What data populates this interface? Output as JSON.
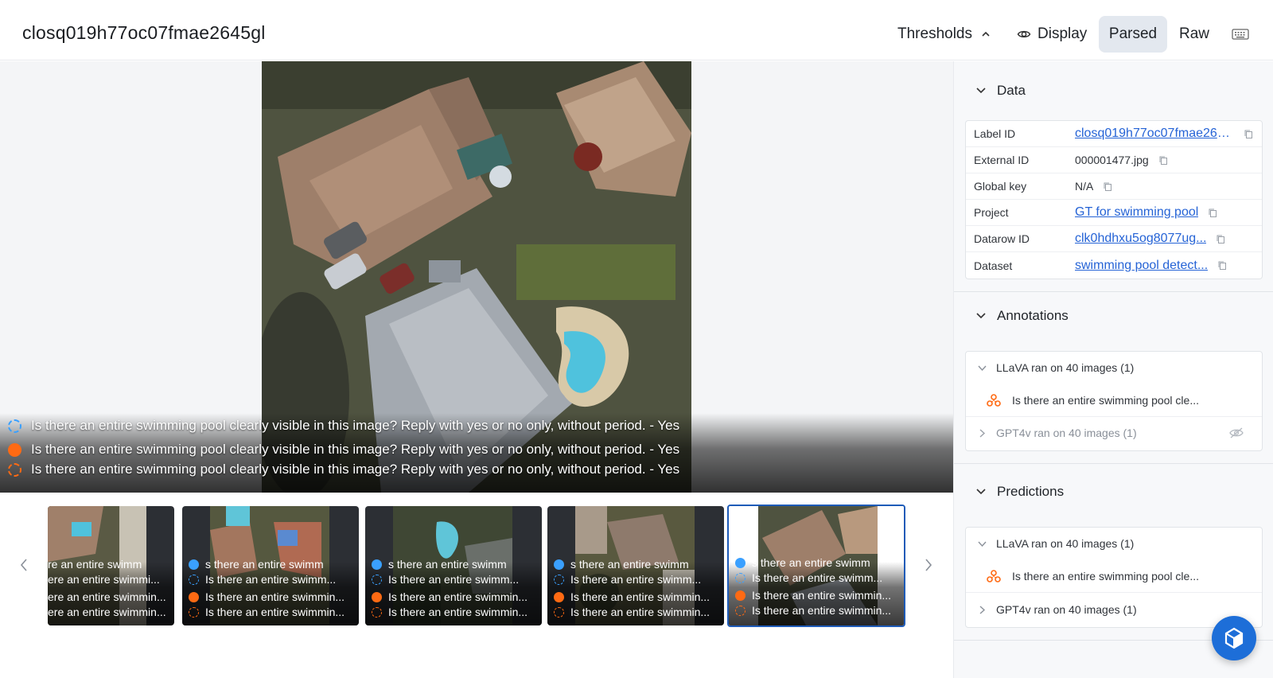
{
  "header": {
    "title": "closq019h77oc07fmae2645gl",
    "thresholds_label": "Thresholds",
    "display_label": "Display",
    "parsed_label": "Parsed",
    "raw_label": "Raw"
  },
  "viewer": {
    "overlay_lines": [
      "Is there an entire swimming pool clearly visible in this image? Reply with yes or no only, without period. - Yes",
      "Is there an entire swimming pool clearly visible in this image? Reply with yes or no only, without period. - Yes",
      "Is there an entire swimming pool clearly visible in this image? Reply with yes or no only, without period. - Yes"
    ]
  },
  "thumbnails": [
    {
      "lines": [
        "re an entire swimm",
        "ere an entire swimmi...",
        "ere an entire swimmin...",
        "ere an entire swimmin..."
      ]
    },
    {
      "lines": [
        "s there an entire swimm",
        "Is there an entire swimm...",
        "Is there an entire swimmin...",
        "Is there an entire swimmin..."
      ]
    },
    {
      "lines": [
        "s there an entire swimm",
        "Is there an entire swimm...",
        "Is there an entire swimmin...",
        "Is there an entire swimmin..."
      ]
    },
    {
      "lines": [
        "s there an entire swimm",
        "Is there an entire swimm...",
        "Is there an entire swimmin...",
        "Is there an entire swimmin..."
      ]
    },
    {
      "lines": [
        "s there an entire swimm",
        "Is there an entire swimm...",
        "Is there an entire swimmin...",
        "Is there an entire swimmin..."
      ]
    }
  ],
  "panel": {
    "data_title": "Data",
    "data_rows": [
      {
        "key": "Label ID",
        "value": "closq019h77oc07fmae2645gl"
      },
      {
        "key": "External ID",
        "value": "000001477.jpg"
      },
      {
        "key": "Global key",
        "value": "N/A"
      },
      {
        "key": "Project",
        "value": "GT for swimming pool"
      },
      {
        "key": "Datarow ID",
        "value": "clk0hdhxu5og8077ug..."
      },
      {
        "key": "Dataset",
        "value": "swimming pool detect..."
      }
    ],
    "annotations_title": "Annotations",
    "annotations": {
      "group1": "LLaVA ran on 40 images (1)",
      "item1": "Is there an entire swimming pool cle...",
      "group2": "GPT4v ran on 40 images (1)"
    },
    "predictions_title": "Predictions",
    "predictions": {
      "group1": "LLaVA ran on 40 images (1)",
      "item1": "Is there an entire swimming pool cle...",
      "group2": "GPT4v ran on 40 images (1)"
    }
  },
  "colors": {
    "accent": "#1d6ed8",
    "link": "#2563d6",
    "annotation_blue": "#3aa0ff",
    "prediction_orange": "#ff6a13"
  }
}
